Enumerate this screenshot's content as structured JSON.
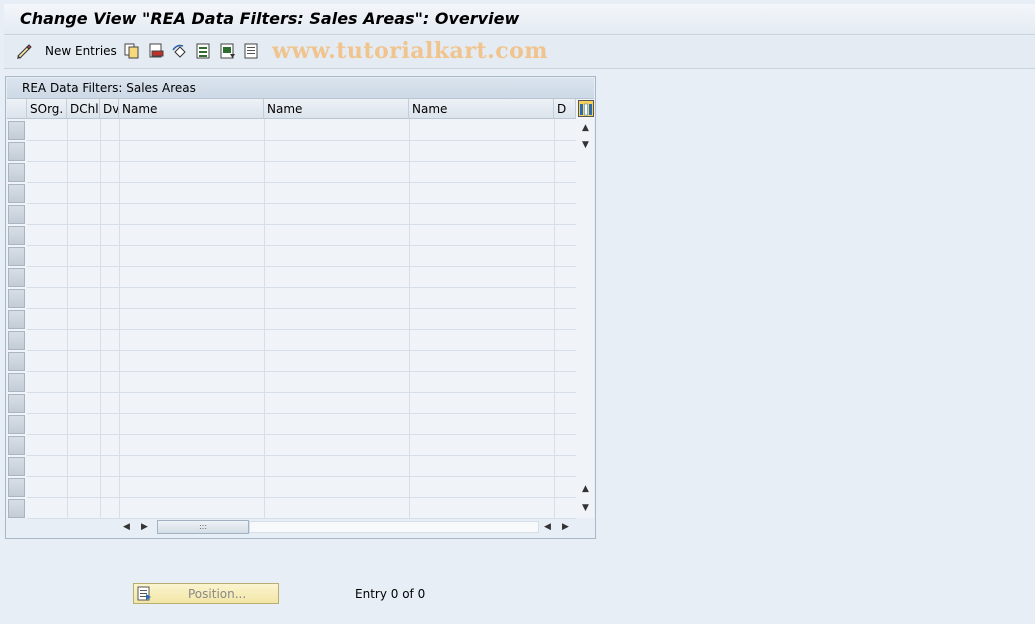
{
  "window": {
    "title": "Change View \"REA Data Filters: Sales Areas\": Overview"
  },
  "toolbar": {
    "new_entries_label": "New Entries",
    "watermark": "www.tutorialkart.com",
    "icons": [
      "edit-pencil-icon",
      "copy-icon",
      "delete-icon",
      "undo-icon",
      "select-all-icon",
      "select-block-icon",
      "deselect-all-icon"
    ]
  },
  "panel": {
    "title": "REA Data Filters: Sales Areas",
    "columns": [
      "SOrg.",
      "DChl",
      "Dv",
      "Name",
      "Name",
      "Name",
      "D"
    ],
    "row_count": 19
  },
  "footer": {
    "position_label": "Position...",
    "entry_text": "Entry 0 of 0"
  },
  "colors": {
    "background": "#e8eef5",
    "button_yellow": "#f2e6a6",
    "watermark": "#f0c48c"
  }
}
